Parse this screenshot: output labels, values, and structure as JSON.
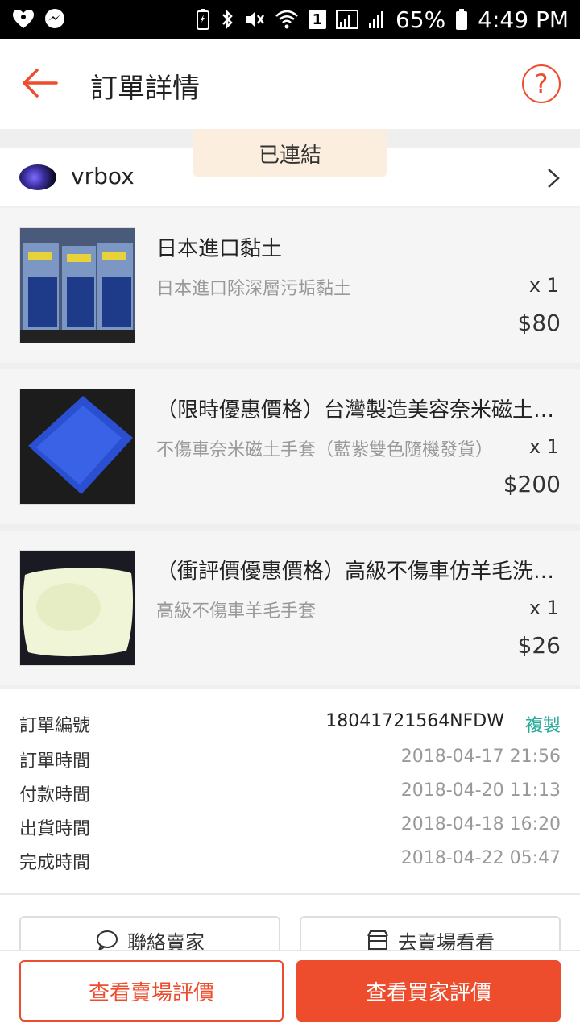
{
  "status_bar": {
    "battery": "65%",
    "time": "4:49 PM",
    "sim_badge": "1"
  },
  "header": {
    "title": "訂單詳情"
  },
  "connected_label": "已連結",
  "shop": {
    "name": "vrbox"
  },
  "items": [
    {
      "name": "日本進口黏土",
      "variation": "日本進口除深層污垢黏土",
      "qty": "x 1",
      "price": "$80"
    },
    {
      "name": "（限時優惠價格）台灣製造美容奈米磁土手套",
      "variation": "不傷車奈米磁土手套（藍紫雙色隨機發貨）",
      "qty": "x 1",
      "price": "$200"
    },
    {
      "name": "（衝評價優惠價格）高級不傷車仿羊毛洗車手套",
      "variation": "高級不傷車羊毛手套",
      "qty": "x 1",
      "price": "$26"
    }
  ],
  "order_info": {
    "order_no_label": "訂單編號",
    "order_no": "18041721564NFDW",
    "copy_label": "複製",
    "rows": [
      {
        "label": "訂單時間",
        "value": "2018-04-17 21:56"
      },
      {
        "label": "付款時間",
        "value": "2018-04-20 11:13"
      },
      {
        "label": "出貨時間",
        "value": "2018-04-18 16:20"
      },
      {
        "label": "完成時間",
        "value": "2018-04-22 05:47"
      }
    ]
  },
  "actions": {
    "contact_seller": "聯絡賣家",
    "visit_shop": "去賣場看看"
  },
  "bottom": {
    "view_shop_rating": "查看賣場評價",
    "view_buyer_rating": "查看買家評價"
  },
  "colors": {
    "brand": "#ee4d2d",
    "copy": "#26aa99",
    "connected_bg": "#fbeede"
  }
}
